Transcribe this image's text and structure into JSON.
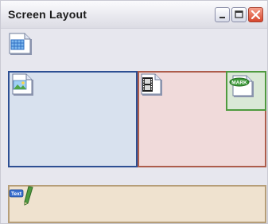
{
  "window": {
    "title": "Screen Layout",
    "controls": {
      "minimize": "minimize",
      "maximize": "maximize",
      "close": "close"
    }
  },
  "icons": {
    "layout_grid": "grid-document-icon",
    "image_region": "image-document-icon",
    "video_region": "film-document-icon",
    "mark_region": "mark-document-icon",
    "text_region": "text-pen-icon"
  },
  "badges": {
    "mark": "MARK",
    "text": "Text"
  },
  "colors": {
    "image_region_fill": "#d8e1ee",
    "image_region_border": "#2d4f93",
    "video_region_fill": "#f0dada",
    "video_region_border": "#ad5c4b",
    "mark_region_fill": "#dae8d6",
    "mark_region_border": "#4f9a3f",
    "text_region_fill": "#efe2cf",
    "text_region_border": "#b69e78",
    "close_button": "#d6452c"
  }
}
